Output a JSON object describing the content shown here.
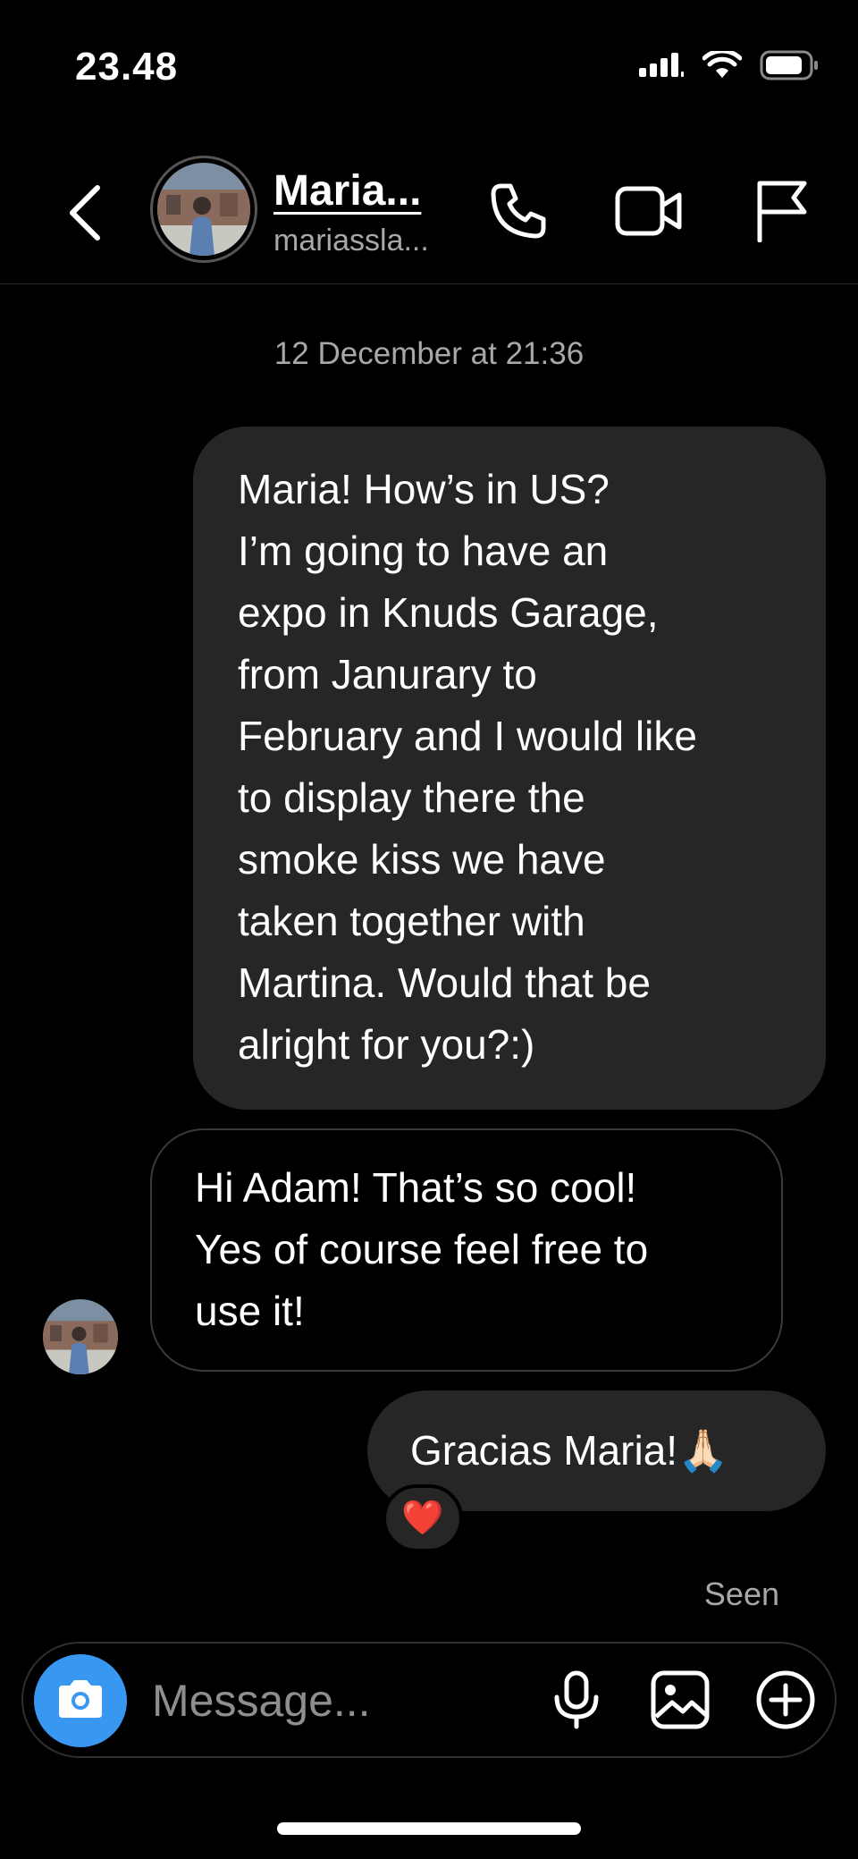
{
  "status_bar": {
    "time": "23.48",
    "icons": [
      "cellular-signal-icon",
      "wifi-icon",
      "battery-icon"
    ]
  },
  "header": {
    "name": "Maria...",
    "username": "mariassla...",
    "icons": [
      "back-chevron-icon",
      "phone-icon",
      "video-camera-icon",
      "flag-icon"
    ]
  },
  "chat": {
    "timestamp": "12 December at 21:36",
    "messages": [
      {
        "direction": "outgoing",
        "lines": [
          "Maria! How’s in US?",
          "I’m going to have an",
          "expo in Knuds Garage,",
          "from Janurary to",
          "February and I would like",
          "to display there the",
          "smoke kiss we have",
          "taken together with",
          "Martina. Would that be",
          "alright for you?:)"
        ]
      },
      {
        "direction": "incoming",
        "lines": [
          "Hi Adam! That’s so cool!",
          "Yes of course feel free to",
          "use it!"
        ]
      },
      {
        "direction": "outgoing",
        "text": "Gracias Maria!",
        "emoji": "🙏🏻",
        "reaction": "❤️"
      }
    ],
    "seen_label": "Seen"
  },
  "composer": {
    "placeholder": "Message...",
    "icons": [
      "camera-icon",
      "microphone-icon",
      "gallery-icon",
      "plus-circle-icon"
    ]
  },
  "colors": {
    "background": "#000000",
    "outgoing_bubble": "#262626",
    "incoming_border": "#3a3a3a",
    "secondary_text": "#a8a8a8",
    "camera_button": "#3897f0"
  }
}
